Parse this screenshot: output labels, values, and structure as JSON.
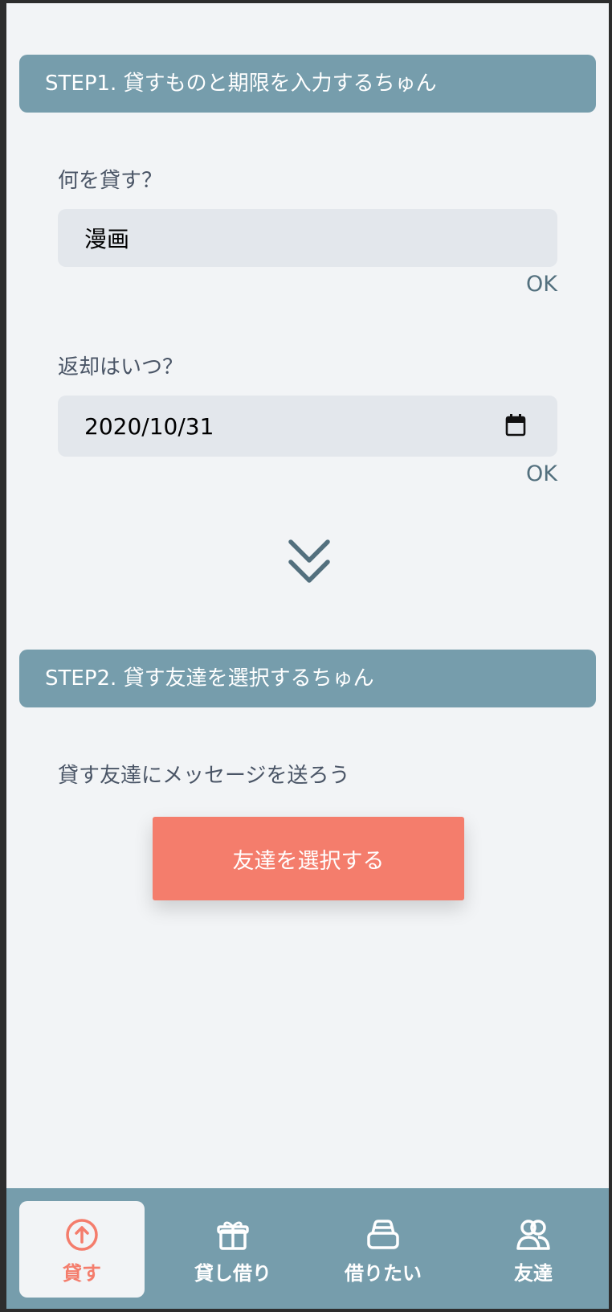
{
  "step1": {
    "header": "STEP1. 貸すものと期限を入力するちゅん",
    "item_label": "何を貸す？",
    "item_value": "漫画",
    "item_ok": "OK",
    "date_label": "返却はいつ？",
    "date_value": "2020/10/31",
    "date_ok": "OK"
  },
  "step2": {
    "header": "STEP2. 貸す友達を選択するちゅん",
    "message": "貸す友達にメッセージを送ろう",
    "select_button": "友達を選択する"
  },
  "nav": {
    "items": [
      {
        "label": "貸す",
        "icon": "arrow-up-circle-icon",
        "active": true
      },
      {
        "label": "貸し借り",
        "icon": "gift-icon",
        "active": false
      },
      {
        "label": "借りたい",
        "icon": "inbox-icon",
        "active": false
      },
      {
        "label": "友達",
        "icon": "users-icon",
        "active": false
      }
    ]
  },
  "colors": {
    "header_bg": "#769dac",
    "accent": "#f47d6c",
    "background": "#f2f4f6",
    "input_bg": "#e3e7ec"
  }
}
